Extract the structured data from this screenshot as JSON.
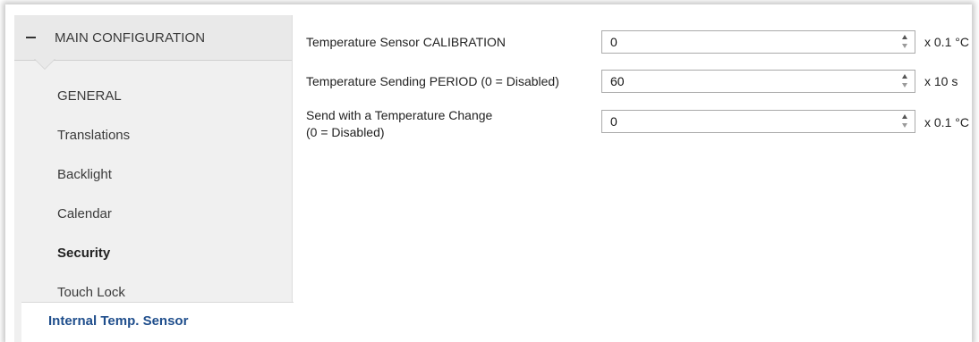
{
  "sidebar": {
    "header": {
      "label": "MAIN CONFIGURATION",
      "icon": "minus-icon"
    },
    "items": [
      {
        "label": "GENERAL",
        "bold": false
      },
      {
        "label": "Translations",
        "bold": false
      },
      {
        "label": "Backlight",
        "bold": false
      },
      {
        "label": "Calendar",
        "bold": false
      },
      {
        "label": "Security",
        "bold": true
      },
      {
        "label": "Touch Lock",
        "bold": false
      },
      {
        "label": "Internal Temp. Sensor",
        "bold": true,
        "selected": true
      }
    ]
  },
  "settings": [
    {
      "label": "Temperature Sensor CALIBRATION",
      "value": "0",
      "unit": "x 0.1 °C"
    },
    {
      "label": "Temperature Sending PERIOD (0 = Disabled)",
      "value": "60",
      "unit": "x 10 s"
    },
    {
      "label_line1": "Send with a Temperature Change",
      "label_line2": "(0 = Disabled)",
      "value": "0",
      "unit": "x 0.1 °C"
    }
  ],
  "colors": {
    "selected_text": "#1f4e8c",
    "sidebar_bg": "#f0f0f0",
    "header_bg": "#e9e9e9"
  }
}
